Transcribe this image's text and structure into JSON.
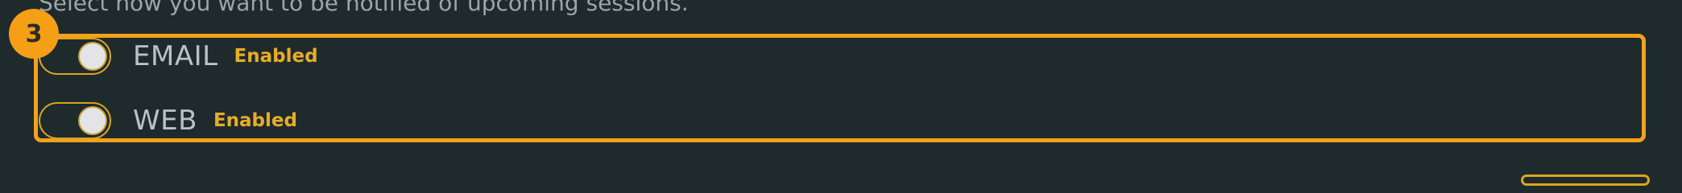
{
  "notification_section": {
    "description": "Select how you want to be notified of upcoming sessions.",
    "step_badge": "3",
    "options": [
      {
        "label": "EMAIL",
        "status": "Enabled",
        "enabled": true
      },
      {
        "label": "WEB",
        "status": "Enabled",
        "enabled": true
      }
    ]
  },
  "colors": {
    "background": "#1f2a2c",
    "highlight": "#f5a11b",
    "status_text": "#e6ad2a"
  }
}
